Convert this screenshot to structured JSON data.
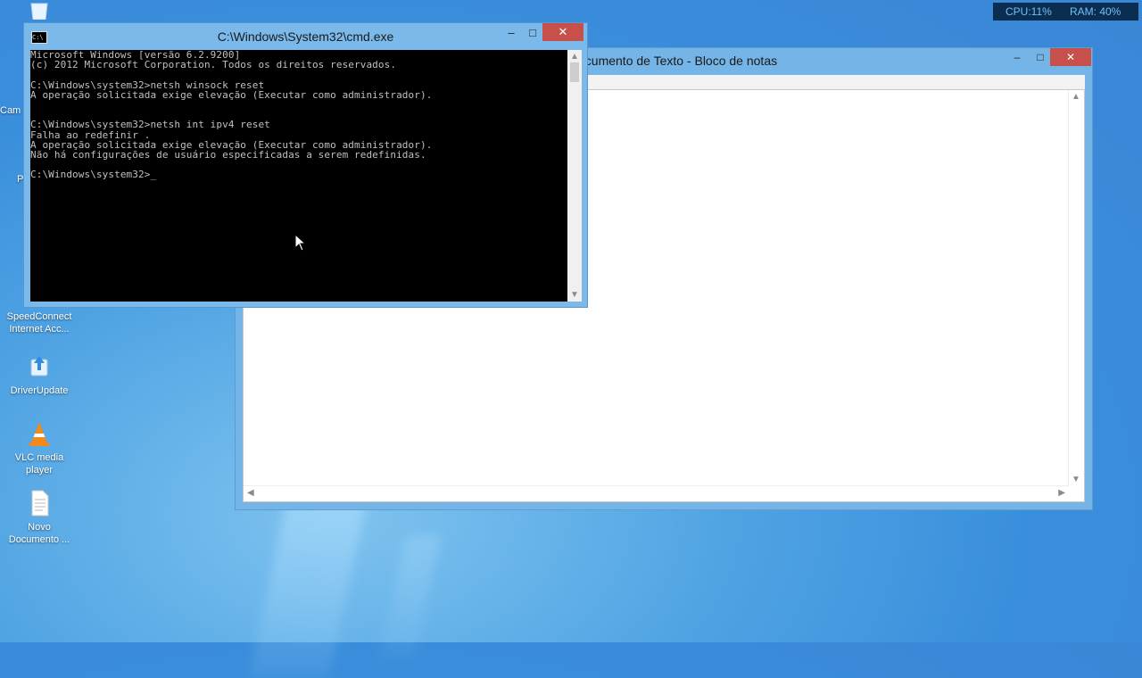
{
  "tray": {
    "cpu": "CPU:11%",
    "ram": "RAM: 40%"
  },
  "desktop": {
    "partials": [
      "Cam",
      "P"
    ],
    "icons": [
      {
        "label": "SpeedConnect Internet Acc..."
      },
      {
        "label": "DriverUpdate"
      },
      {
        "label": "VLC media player"
      },
      {
        "label": "Novo Documento ..."
      }
    ]
  },
  "notepad": {
    "title": "ocumento de Texto - Bloco de notas",
    "minimize": "–",
    "maximize": "□",
    "close": "✕"
  },
  "cmd": {
    "title": "C:\\Windows\\System32\\cmd.exe",
    "sysicon": "C:\\",
    "minimize": "–",
    "maximize": "□",
    "close": "✕",
    "output": "Microsoft Windows [versão 6.2.9200]\n(c) 2012 Microsoft Corporation. Todos os direitos reservados.\n\nC:\\Windows\\system32>netsh winsock reset\nA operação solicitada exige elevação (Executar como administrador).\n\n\nC:\\Windows\\system32>netsh int ipv4 reset\nFalha ao redefinir .\nA operação solicitada exige elevação (Executar como administrador).\nNão há configurações de usuário especificadas a serem redefinidas.\n\nC:\\Windows\\system32>_"
  },
  "icons": {
    "scroll_up": "▲",
    "scroll_down": "▼",
    "scroll_left": "◀",
    "scroll_right": "▶"
  }
}
